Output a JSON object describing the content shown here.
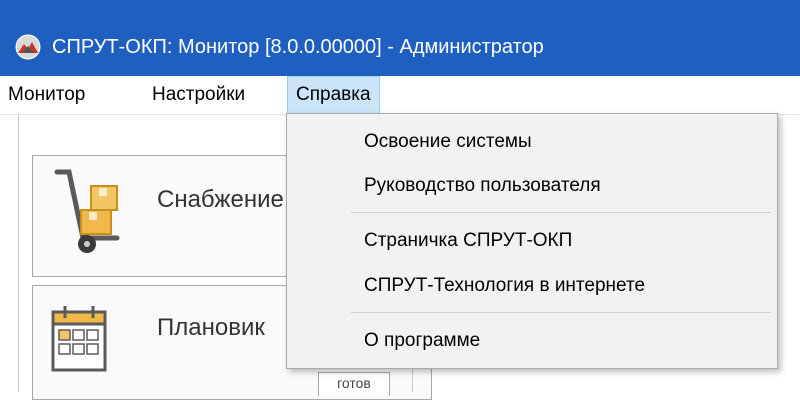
{
  "window": {
    "title": "СПРУТ-ОКП: Монитор [8.0.0.00000] - Администратор",
    "title_bar_color": "#1f5fbf",
    "app_icon": "sprut-app-icon"
  },
  "menubar": {
    "items": [
      {
        "label": "Монитор"
      },
      {
        "label": "Настройки"
      },
      {
        "label": "Справка",
        "active": true
      }
    ]
  },
  "help_menu": {
    "items": [
      {
        "label": "Освоение системы"
      },
      {
        "label": "Руководство пользователя"
      },
      {
        "label": "Страничка СПРУТ-ОКП"
      },
      {
        "label": "СПРУТ-Технология в интернете"
      },
      {
        "label": "О программе"
      }
    ]
  },
  "modules": [
    {
      "title": "Снабжение",
      "icon": "hand-truck-boxes-icon"
    },
    {
      "title": "Плановик",
      "icon": "calendar-icon",
      "status": "готов"
    }
  ]
}
